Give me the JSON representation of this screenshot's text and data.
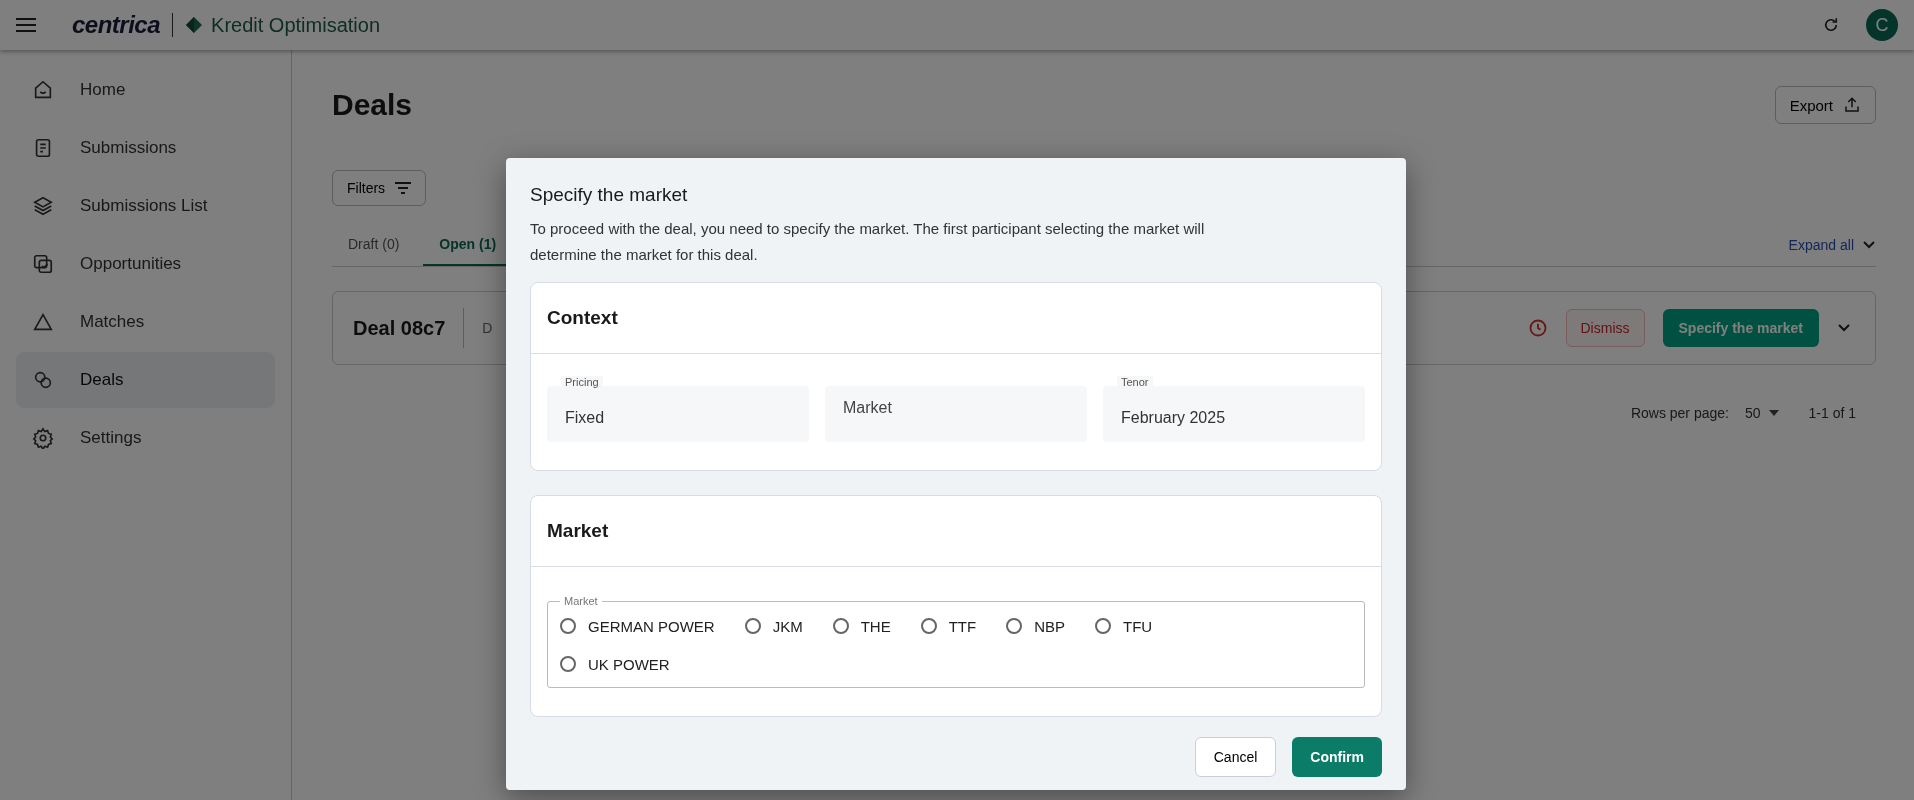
{
  "header": {
    "brand": "centrica",
    "product": "Kredit Optimisation",
    "avatar": "C"
  },
  "sidebar": {
    "items": [
      {
        "label": "Home",
        "selected": false
      },
      {
        "label": "Submissions",
        "selected": false
      },
      {
        "label": "Submissions List",
        "selected": false
      },
      {
        "label": "Opportunities",
        "selected": false
      },
      {
        "label": "Matches",
        "selected": false
      },
      {
        "label": "Deals",
        "selected": true
      },
      {
        "label": "Settings",
        "selected": false
      }
    ]
  },
  "page": {
    "title": "Deals",
    "export": "Export",
    "filters": "Filters",
    "tabs": [
      {
        "label": "Draft (0)",
        "selected": false
      },
      {
        "label": "Open (1)",
        "selected": true
      }
    ],
    "expand_all": "Expand all",
    "deal": {
      "name": "Deal 08c7",
      "column_2": "D",
      "dismiss": "Dismiss",
      "action": "Specify the market"
    },
    "pagination": {
      "rows_per_page": "Rows per page:",
      "page_size": "50",
      "range": "1-1 of 1"
    }
  },
  "dialog": {
    "title": "Specify the market",
    "description": "To proceed with the deal, you need to specify the market. The first participant selecting the market will determine the market for this deal.",
    "context": {
      "title": "Context",
      "fields": [
        {
          "label": "Pricing",
          "value": "Fixed"
        },
        {
          "placeholder": "Market"
        },
        {
          "label": "Tenor",
          "value": "February 2025"
        }
      ]
    },
    "market": {
      "title": "Market",
      "group_label": "Market",
      "options": [
        {
          "label": "GERMAN POWER",
          "selected": false
        },
        {
          "label": "JKM",
          "selected": false
        },
        {
          "label": "THE",
          "selected": false
        },
        {
          "label": "TTF",
          "selected": false
        },
        {
          "label": "NBP",
          "selected": false
        },
        {
          "label": "TFU",
          "selected": false
        },
        {
          "label": "UK POWER",
          "selected": false
        }
      ]
    },
    "buttons": {
      "cancel": "Cancel",
      "confirm": "Confirm"
    }
  }
}
